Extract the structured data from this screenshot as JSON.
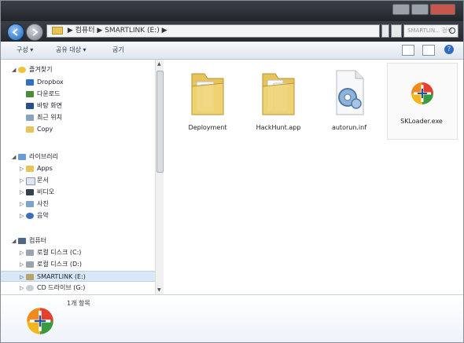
{
  "window": {
    "address_path": "▶ 컴퓨터 ▶ SMARTLINK (E:) ▶",
    "search_placeholder": "SMARTLIN... 검색"
  },
  "toolbar": {
    "organize_label": "구성 ▾",
    "share_label": "공유 대상 ▾",
    "burn_label": "굽기",
    "help_label": "?"
  },
  "nav": {
    "favorites_header": "즐겨찾기",
    "favorites": [
      {
        "label": "Dropbox",
        "icon": "dropbox-icon"
      },
      {
        "label": "다운로드",
        "icon": "downloads-icon"
      },
      {
        "label": "바탕 화면",
        "icon": "desktop-icon"
      },
      {
        "label": "최근 위치",
        "icon": "recent-icon"
      },
      {
        "label": "Copy",
        "icon": "folder-icon"
      }
    ],
    "libraries_header": "라이브러리",
    "libraries": [
      {
        "label": "Apps",
        "icon": "folder-icon"
      },
      {
        "label": "문서",
        "icon": "documents-icon"
      },
      {
        "label": "비디오",
        "icon": "video-icon"
      },
      {
        "label": "사진",
        "icon": "pictures-icon"
      },
      {
        "label": "음악",
        "icon": "music-icon"
      }
    ],
    "computer_header": "컴퓨터",
    "computer": [
      {
        "label": "로컬 디스크 (C:)",
        "icon": "drive-icon"
      },
      {
        "label": "로컬 디스크 (D:)",
        "icon": "drive-icon"
      },
      {
        "label": "SMARTLINK (E:)",
        "icon": "usb-drive-icon",
        "selected": true
      },
      {
        "label": "CD 드라이브 (G:)",
        "icon": "cd-drive-icon"
      }
    ]
  },
  "files": [
    {
      "name": "Deployment",
      "type": "folder"
    },
    {
      "name": "HackHunt.app",
      "type": "folder"
    },
    {
      "name": "autorun.inf",
      "type": "settings-file"
    },
    {
      "name": "SKLoader.exe",
      "type": "exe",
      "selected": true
    }
  ],
  "details": {
    "item_count": "1개 항목"
  },
  "colors": {
    "title_bar": "#2b3037",
    "selection": "#d9e7f7",
    "folder": "#e7c45a"
  }
}
